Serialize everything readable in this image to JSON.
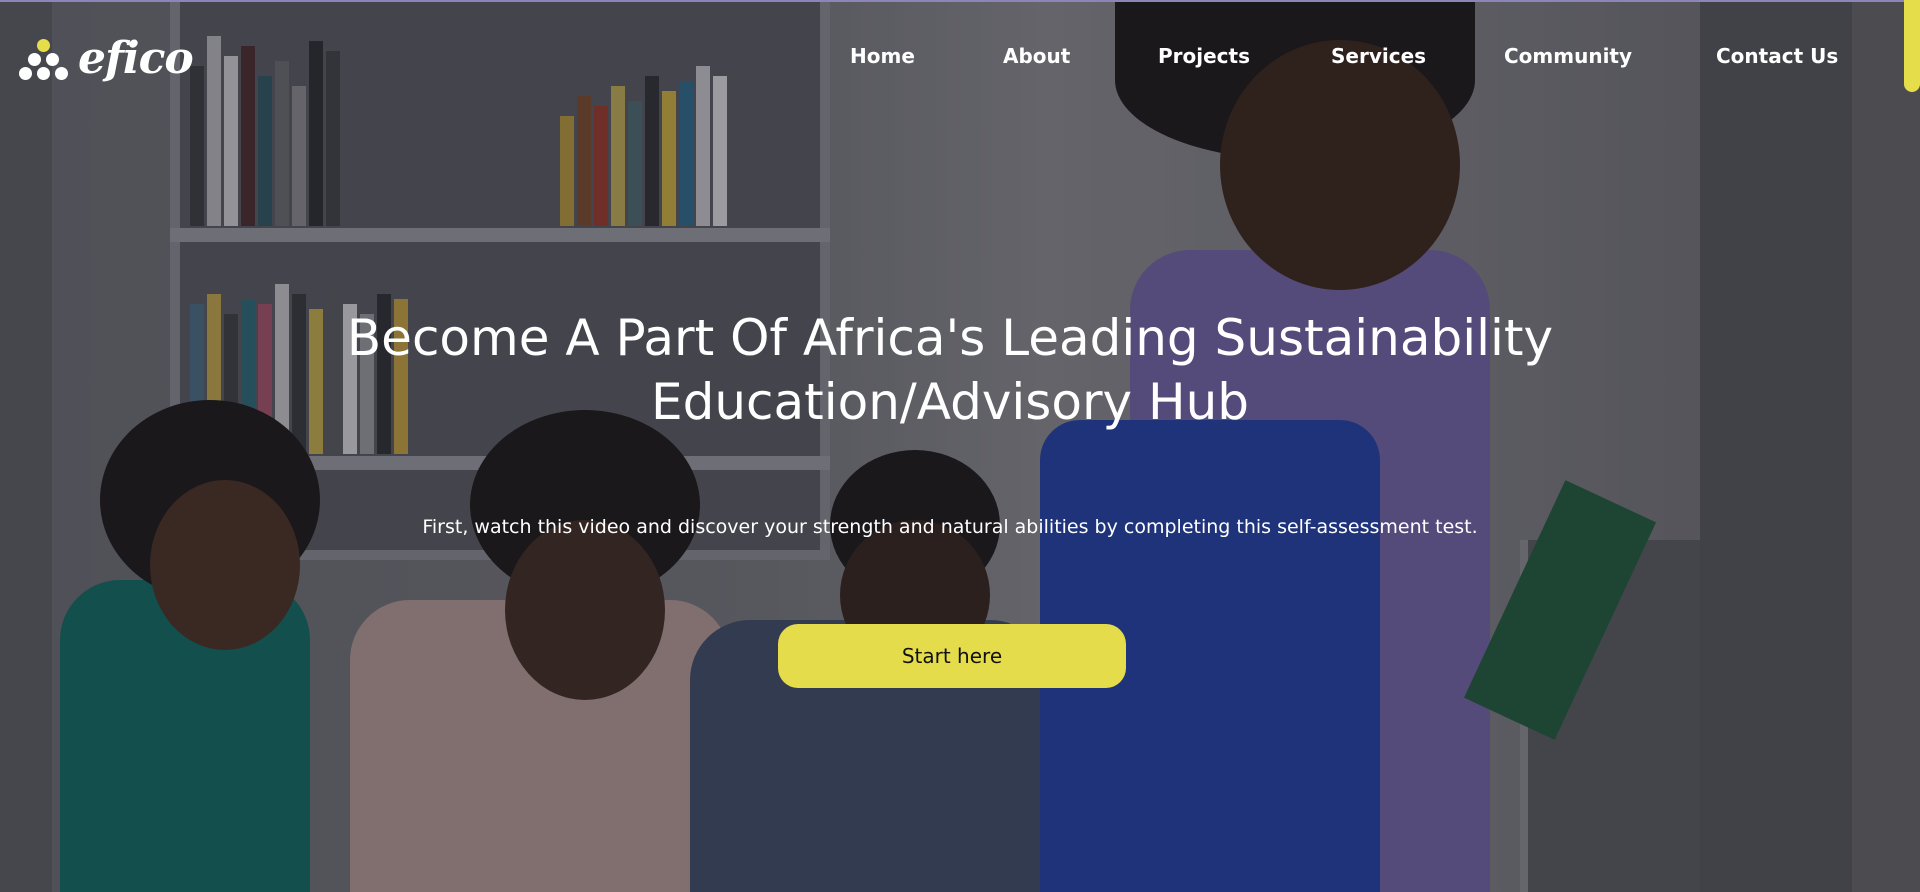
{
  "brand": {
    "name": "efico",
    "accent_color": "#e4dc4a"
  },
  "nav": {
    "items": [
      {
        "label": "Home"
      },
      {
        "label": "About"
      },
      {
        "label": "Projects"
      },
      {
        "label": "Services"
      },
      {
        "label": "Community"
      },
      {
        "label": "Contact Us"
      }
    ]
  },
  "hero": {
    "title_line1": "Become A Part Of Africa's Leading Sustainability",
    "title_line2": "Education/Advisory Hub",
    "subtitle": "First, watch this video and discover your strength and natural abilities by completing this self-assessment test.",
    "cta_label": "Start here",
    "background_image": "students-in-library-photo"
  }
}
